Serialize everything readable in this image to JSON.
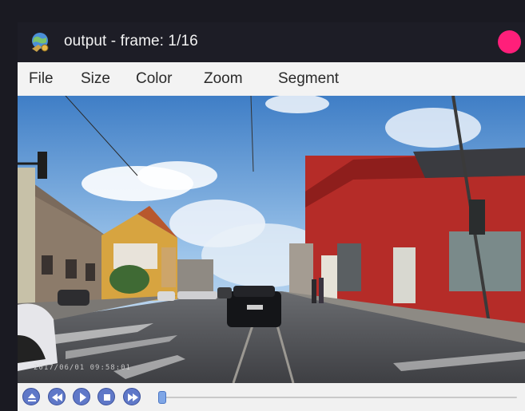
{
  "window": {
    "title": "output - frame: 1/16",
    "close_color": "#ff1f7a",
    "icon": "globe-wrench-icon"
  },
  "menu": {
    "items": [
      {
        "label": "File"
      },
      {
        "label": "Size"
      },
      {
        "label": "Color"
      },
      {
        "label": "Zoom"
      },
      {
        "label": "Segment"
      }
    ]
  },
  "player": {
    "frame_current": 1,
    "frame_total": 16,
    "seek_progress": 0.0,
    "osd_timestamp": "2017/06/01 09:58:01",
    "buttons": [
      {
        "icon": "eject-icon"
      },
      {
        "icon": "rewind-icon"
      },
      {
        "icon": "play-icon"
      },
      {
        "icon": "stop-icon"
      },
      {
        "icon": "fast-forward-icon"
      }
    ]
  }
}
